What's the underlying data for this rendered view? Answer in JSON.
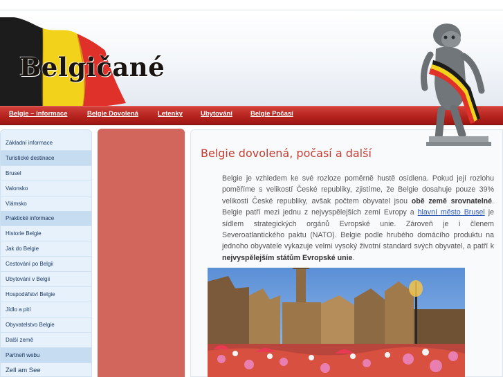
{
  "header": {
    "logo_text": "Belgičané",
    "colors": {
      "black": "#1c1c1c",
      "yellow": "#f2d21a",
      "red": "#e0302a"
    }
  },
  "nav": {
    "items": [
      {
        "label": "Belgie – informace"
      },
      {
        "label": "Belgie Dovolená"
      },
      {
        "label": "Letenky"
      },
      {
        "label": "Ubytování"
      },
      {
        "label": "Belgie Počasí"
      }
    ]
  },
  "sidebar": {
    "items": [
      {
        "label": "Základní informace",
        "section": false
      },
      {
        "label": "Turistické destinace",
        "section": true
      },
      {
        "label": "Brusel",
        "section": false
      },
      {
        "label": "Valonsko",
        "section": false
      },
      {
        "label": "Vlámsko",
        "section": false
      },
      {
        "label": "Praktické informace",
        "section": true
      },
      {
        "label": "Historie Belgie",
        "section": false
      },
      {
        "label": "Jak do Belgie",
        "section": false
      },
      {
        "label": "Cestování po Belgii",
        "section": false
      },
      {
        "label": "Ubytování v Belgii",
        "section": false
      },
      {
        "label": "Hospodářství Belgie",
        "section": false
      },
      {
        "label": "Jídlo a pití",
        "section": false
      },
      {
        "label": "Obyvatelstvo Belgie",
        "section": false
      },
      {
        "label": "Další země",
        "section": false
      },
      {
        "label": "Partneři webu",
        "section": true
      },
      {
        "label": "Zell am See",
        "section": false
      }
    ]
  },
  "content": {
    "title": "Belgie dovolená, počasí a další",
    "p1": "Belgie je vzhledem ke své rozloze poměrně hustě osídlena. Pokud její rozlohu poměříme s velikostí České republiky, zjistíme, že Belgie dosahuje pouze 39% velikosti České republiky, avšak počtem obyvatel jsou ",
    "p1_bold": "obě země srovnatelné",
    "p2": ". Belgie patří mezi jednu z nejvyspělejších zemí Evropy a ",
    "link": "hlavní město Brusel",
    "p3": " je sídlem strategických orgánů Evropské unie. Zároveň je i členem Severoatlantického paktu (NATO). Belgie podle hrubého domácího produktu na jednoho obyvatele vykazuje velmi vysoký životní standard svých obyvatel, a patří k ",
    "p3_bold": "nejvyspělejším státům Evropské unie",
    "p4": "."
  }
}
